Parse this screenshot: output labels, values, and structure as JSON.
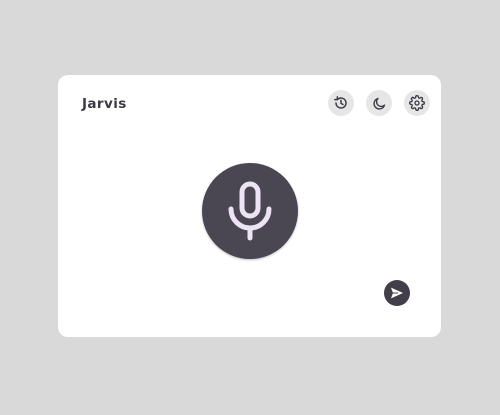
{
  "app": {
    "title": "Jarvis"
  },
  "toolbar": {
    "buttons": [
      {
        "icon": "history-icon"
      },
      {
        "icon": "moon-icon"
      },
      {
        "icon": "gear-icon"
      }
    ]
  },
  "main": {
    "mic_icon": "microphone-icon",
    "send_icon": "send-icon"
  },
  "colors": {
    "background": "#d9d9d9",
    "card": "#ffffff",
    "accent_dark": "#4a4652",
    "icon_light": "#ece4f5",
    "icon_dark": "#3d3a44",
    "button_gray": "#e6e6e6"
  }
}
